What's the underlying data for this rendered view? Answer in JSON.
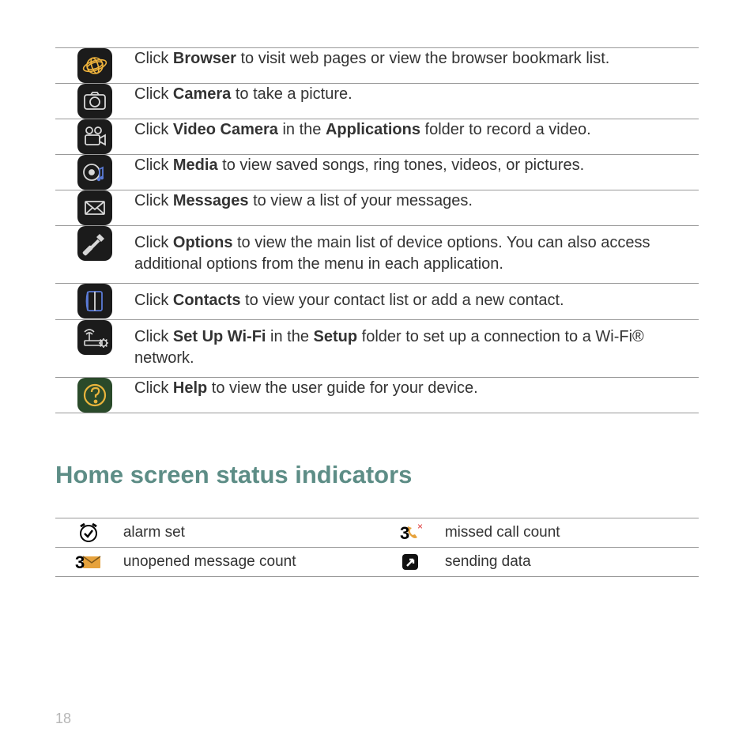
{
  "rows": [
    {
      "pre": "Click ",
      "b1": "Browser",
      "mid": " to visit web pages or view the browser bookmark list.",
      "b2": "",
      "tail": ""
    },
    {
      "pre": "Click ",
      "b1": "Camera",
      "mid": " to take a picture.",
      "b2": "",
      "tail": ""
    },
    {
      "pre": "Click ",
      "b1": "Video Camera",
      "mid": " in the ",
      "b2": "Applications",
      "tail": " folder to record a video."
    },
    {
      "pre": "Click ",
      "b1": "Media",
      "mid": " to view saved songs, ring tones, videos, or pictures.",
      "b2": "",
      "tail": ""
    },
    {
      "pre": "Click ",
      "b1": "Messages",
      "mid": " to view a list of your messages.",
      "b2": "",
      "tail": ""
    },
    {
      "pre": "Click ",
      "b1": "Options",
      "mid": " to view the main list of device options. You can also access additional options from the menu in each application.",
      "b2": "",
      "tail": ""
    },
    {
      "pre": "Click ",
      "b1": "Contacts",
      "mid": " to view your contact list or add a new contact.",
      "b2": "",
      "tail": ""
    },
    {
      "pre": "Click ",
      "b1": "Set Up Wi-Fi",
      "mid": " in the ",
      "b2": "Setup",
      "tail": " folder to set up a connection to a Wi-Fi® network."
    },
    {
      "pre": "Click ",
      "b1": "Help",
      "mid": " to view the user guide for your device.",
      "b2": "",
      "tail": ""
    }
  ],
  "section_title": "Home screen status indicators",
  "status": {
    "r1c1": "alarm set",
    "r1c2": "missed call count",
    "r2c1": "unopened message count",
    "r2c2": "sending data"
  },
  "page_number": "18"
}
